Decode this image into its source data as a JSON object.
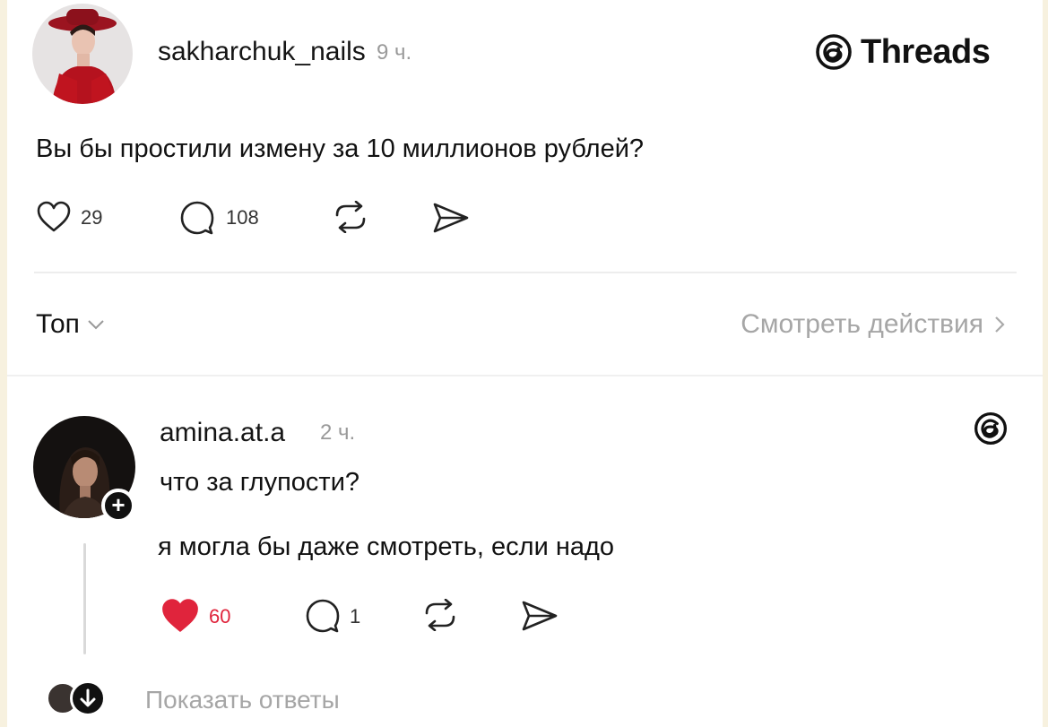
{
  "post": {
    "username": "sakharchuk_nails",
    "time": "9 ч.",
    "brand": "Threads",
    "text": "Вы бы простили измену за 10 миллионов рублей?",
    "likes": "29",
    "replies": "108"
  },
  "sort": {
    "label": "Топ",
    "activity_link": "Смотреть действия"
  },
  "reply": {
    "username": "amina.at.a",
    "time": "2 ч.",
    "line1": "что за глупости?",
    "line2": "я могла бы даже смотреть, если надо",
    "likes": "60",
    "replies": "1",
    "like_color": "#e0243c",
    "show_replies": "Показать ответы"
  },
  "icons": {
    "brand": "threads-logo-icon",
    "like": "heart-icon",
    "reply": "comment-icon",
    "repost": "repost-icon",
    "share": "send-icon",
    "follow": "plus-icon",
    "chevron_down": "chevron-down-icon",
    "chevron_right": "chevron-right-icon",
    "expand": "arrow-down-icon"
  }
}
